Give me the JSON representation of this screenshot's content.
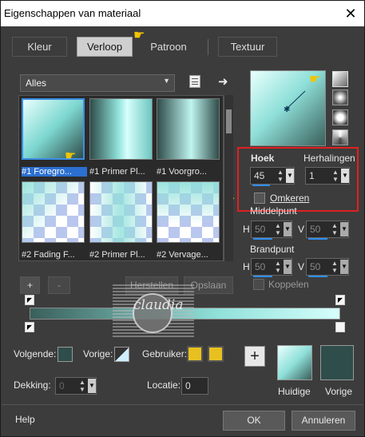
{
  "window": {
    "title": "Eigenschappen van materiaal",
    "close_glyph": "✕"
  },
  "tabs": [
    {
      "label": "Kleur",
      "active": false
    },
    {
      "label": "Verloop",
      "active": true
    },
    {
      "label": "Patroon",
      "active": false
    },
    {
      "label": "Textuur",
      "active": false
    }
  ],
  "gallery": {
    "filter_value": "Alles",
    "items": [
      {
        "caption": "#1 Foregro...",
        "selected": true
      },
      {
        "caption": "#1 Primer Pl...",
        "selected": false
      },
      {
        "caption": "#1 Voorgro...",
        "selected": false
      },
      {
        "caption": "#2 Fading F...",
        "selected": false
      },
      {
        "caption": "#2 Primer Pl...",
        "selected": false
      },
      {
        "caption": "#2 Vervage...",
        "selected": false
      }
    ]
  },
  "gradient_settings": {
    "angle_label": "Hoek",
    "angle_value": "45",
    "repeat_label": "Herhalingen",
    "repeat_value": "1",
    "invert_label": "Omkeren",
    "center_label": "Middelpunt",
    "center_h_label": "H",
    "center_h_value": "50",
    "center_v_label": "V",
    "center_v_value": "50",
    "focal_label": "Brandpunt",
    "focal_h_label": "H",
    "focal_h_value": "50",
    "focal_v_label": "V",
    "focal_v_value": "50",
    "link_label": "Koppelen"
  },
  "editor_buttons": {
    "add": "+",
    "remove": "-",
    "restore": "Herstellen",
    "save": "Opslaan"
  },
  "watermark": {
    "text": "claudia"
  },
  "stop_controls": {
    "next_label": "Volgende:",
    "prev_label": "Vorige:",
    "user_label": "Gebruiker:",
    "opacity_label": "Dekking:",
    "opacity_value": "0",
    "location_label": "Locatie:",
    "location_value": "0",
    "user_color": "#f2c21b"
  },
  "materials": {
    "current_label": "Huidige",
    "previous_label": "Vorige",
    "add_glyph": "+"
  },
  "footer": {
    "help": "Help",
    "ok": "OK",
    "cancel": "Annuleren"
  },
  "colors": {
    "accent_blue": "#2b6fd1",
    "highlight_red": "#e02020",
    "gradient_light": "#d6fffc",
    "gradient_dark": "#2f4d4a"
  }
}
